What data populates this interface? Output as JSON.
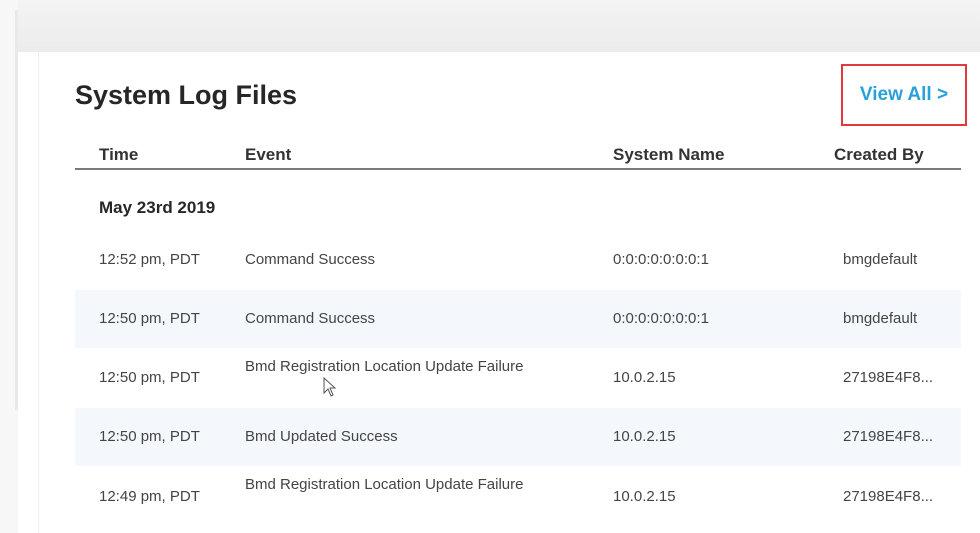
{
  "panel": {
    "title": "System Log Files",
    "view_all_label": "View All >"
  },
  "table": {
    "headers": {
      "time": "Time",
      "event": "Event",
      "system_name": "System Name",
      "created_by": "Created By"
    },
    "groups": [
      {
        "date": "May 23rd 2019",
        "rows": [
          {
            "time": "12:52 pm, PDT",
            "event": "Command Success",
            "system_name": "0:0:0:0:0:0:0:1",
            "created_by": "bmgdefault"
          },
          {
            "time": "12:50 pm, PDT",
            "event": "Command Success",
            "system_name": "0:0:0:0:0:0:0:1",
            "created_by": "bmgdefault"
          },
          {
            "time": "12:50 pm, PDT",
            "event": "Bmd Registration Location Update Failure",
            "system_name": "10.0.2.15",
            "created_by": "27198E4F8..."
          },
          {
            "time": "12:50 pm, PDT",
            "event": "Bmd Updated Success",
            "system_name": "10.0.2.15",
            "created_by": "27198E4F8..."
          },
          {
            "time": "12:49 pm, PDT",
            "event": "Bmd Registration Location Update Failure",
            "system_name": "10.0.2.15",
            "created_by": "27198E4F8..."
          }
        ]
      }
    ]
  },
  "colors": {
    "link": "#2aa0d8",
    "highlight_border": "#e03a3a",
    "stripe": "#f4f8fc"
  },
  "icons": {
    "cursor": "mouse-pointer-icon"
  }
}
